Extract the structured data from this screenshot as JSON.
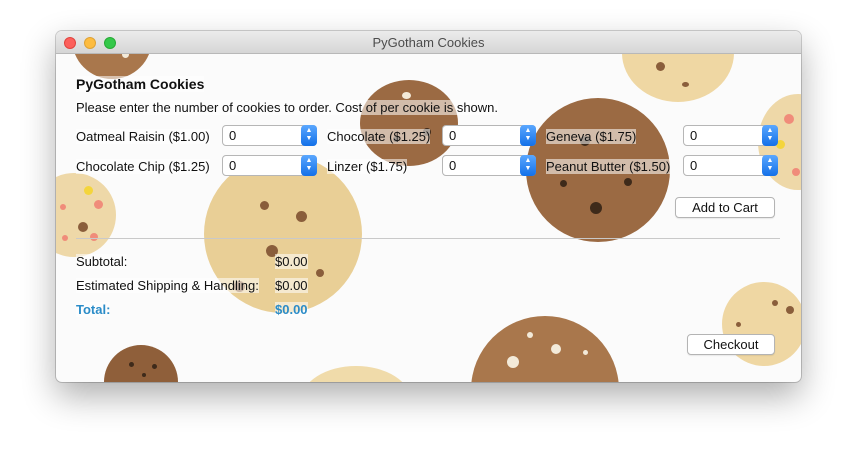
{
  "window": {
    "title": "PyGotham Cookies"
  },
  "form": {
    "heading": "PyGotham Cookies",
    "instructions": "Please enter the number of cookies to order. Cost of per cookie is shown.",
    "cookies": [
      {
        "label": "Oatmeal Raisin ($1.00)",
        "value": "0"
      },
      {
        "label": "Chocolate ($1.25)",
        "value": "0"
      },
      {
        "label": "Geneva ($1.75)",
        "value": "0"
      },
      {
        "label": "Chocolate Chip ($1.25)",
        "value": "0"
      },
      {
        "label": "Linzer ($1.75)",
        "value": "0"
      },
      {
        "label": "Peanut Butter ($1.50)",
        "value": "0"
      }
    ],
    "add_to_cart_label": "Add to Cart"
  },
  "summary": {
    "subtotal_label": "Subtotal:",
    "subtotal_value": "$0.00",
    "shipping_label": "Estimated Shipping & Handling:",
    "shipping_value": "$0.00",
    "total_label": "Total:",
    "total_value": "$0.00",
    "checkout_label": "Checkout"
  },
  "colors": {
    "total_accent": "#2b8cc8",
    "stepper_blue": "#1370e8",
    "cookie_tan": "#e9cf96",
    "cookie_brown": "#9c6c44"
  }
}
